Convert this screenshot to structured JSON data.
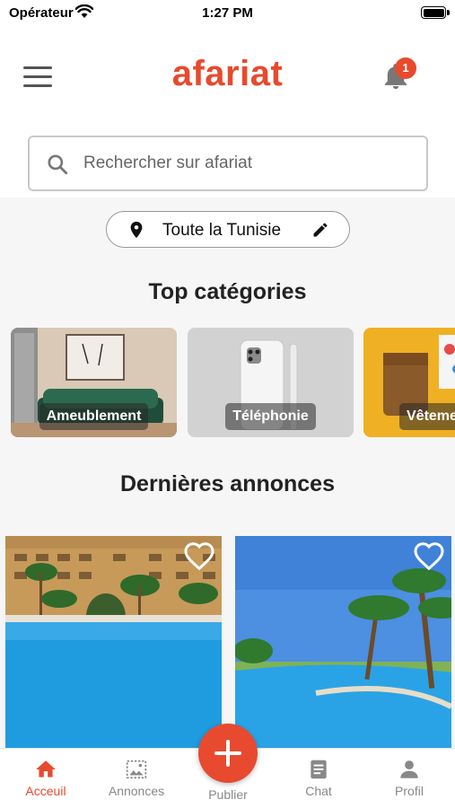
{
  "status_bar": {
    "carrier": "Opérateur",
    "time": "1:27 PM"
  },
  "header": {
    "logo": "afariat",
    "notifications_count": "1"
  },
  "search": {
    "placeholder": "Rechercher sur afariat"
  },
  "location": {
    "label": "Toute la Tunisie"
  },
  "top_categories": {
    "title": "Top catégories",
    "items": [
      {
        "label": "Ameublement"
      },
      {
        "label": "Téléphonie"
      },
      {
        "label": "Vêteme"
      }
    ]
  },
  "latest": {
    "title": "Dernières annonces"
  },
  "bottom_nav": {
    "items": [
      {
        "label": "Acceuil",
        "icon": "home-icon",
        "active": true
      },
      {
        "label": "Annonces",
        "icon": "gallery-icon"
      },
      {
        "label": "Publier",
        "icon": "plus-icon"
      },
      {
        "label": "Chat",
        "icon": "chat-icon"
      },
      {
        "label": "Profil",
        "icon": "profile-icon"
      }
    ]
  },
  "colors": {
    "brand": "#e74a2e",
    "inactive": "#888888"
  }
}
